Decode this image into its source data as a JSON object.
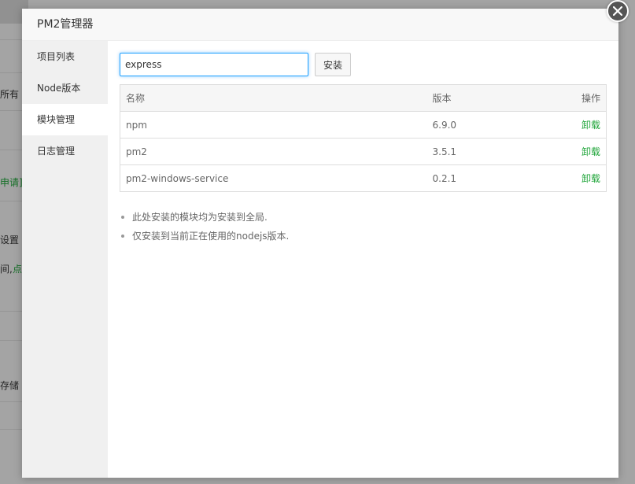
{
  "background": {
    "fragments": [
      "所有",
      "申请]",
      "设置",
      "间, ",
      "点",
      "存储"
    ]
  },
  "dialog": {
    "title": "PM2管理器",
    "sidebar": {
      "items": [
        {
          "label": "项目列表"
        },
        {
          "label": "Node版本"
        },
        {
          "label": "模块管理"
        },
        {
          "label": "日志管理"
        }
      ],
      "active_index": 2
    },
    "search": {
      "value": "express",
      "button_label": "安装"
    },
    "table": {
      "headers": {
        "name": "名称",
        "version": "版本",
        "action": "操作"
      },
      "rows": [
        {
          "name": "npm",
          "version": "6.9.0",
          "action": "卸载"
        },
        {
          "name": "pm2",
          "version": "3.5.1",
          "action": "卸载"
        },
        {
          "name": "pm2-windows-service",
          "version": "0.2.1",
          "action": "卸载"
        }
      ]
    },
    "tips": [
      "此处安装的模块均为安装到全局.",
      "仅安装到当前正在使用的nodejs版本."
    ],
    "close_icon": "close-icon"
  },
  "colors": {
    "accent_green": "#20a53a",
    "focus_blue": "#20a0ff"
  }
}
